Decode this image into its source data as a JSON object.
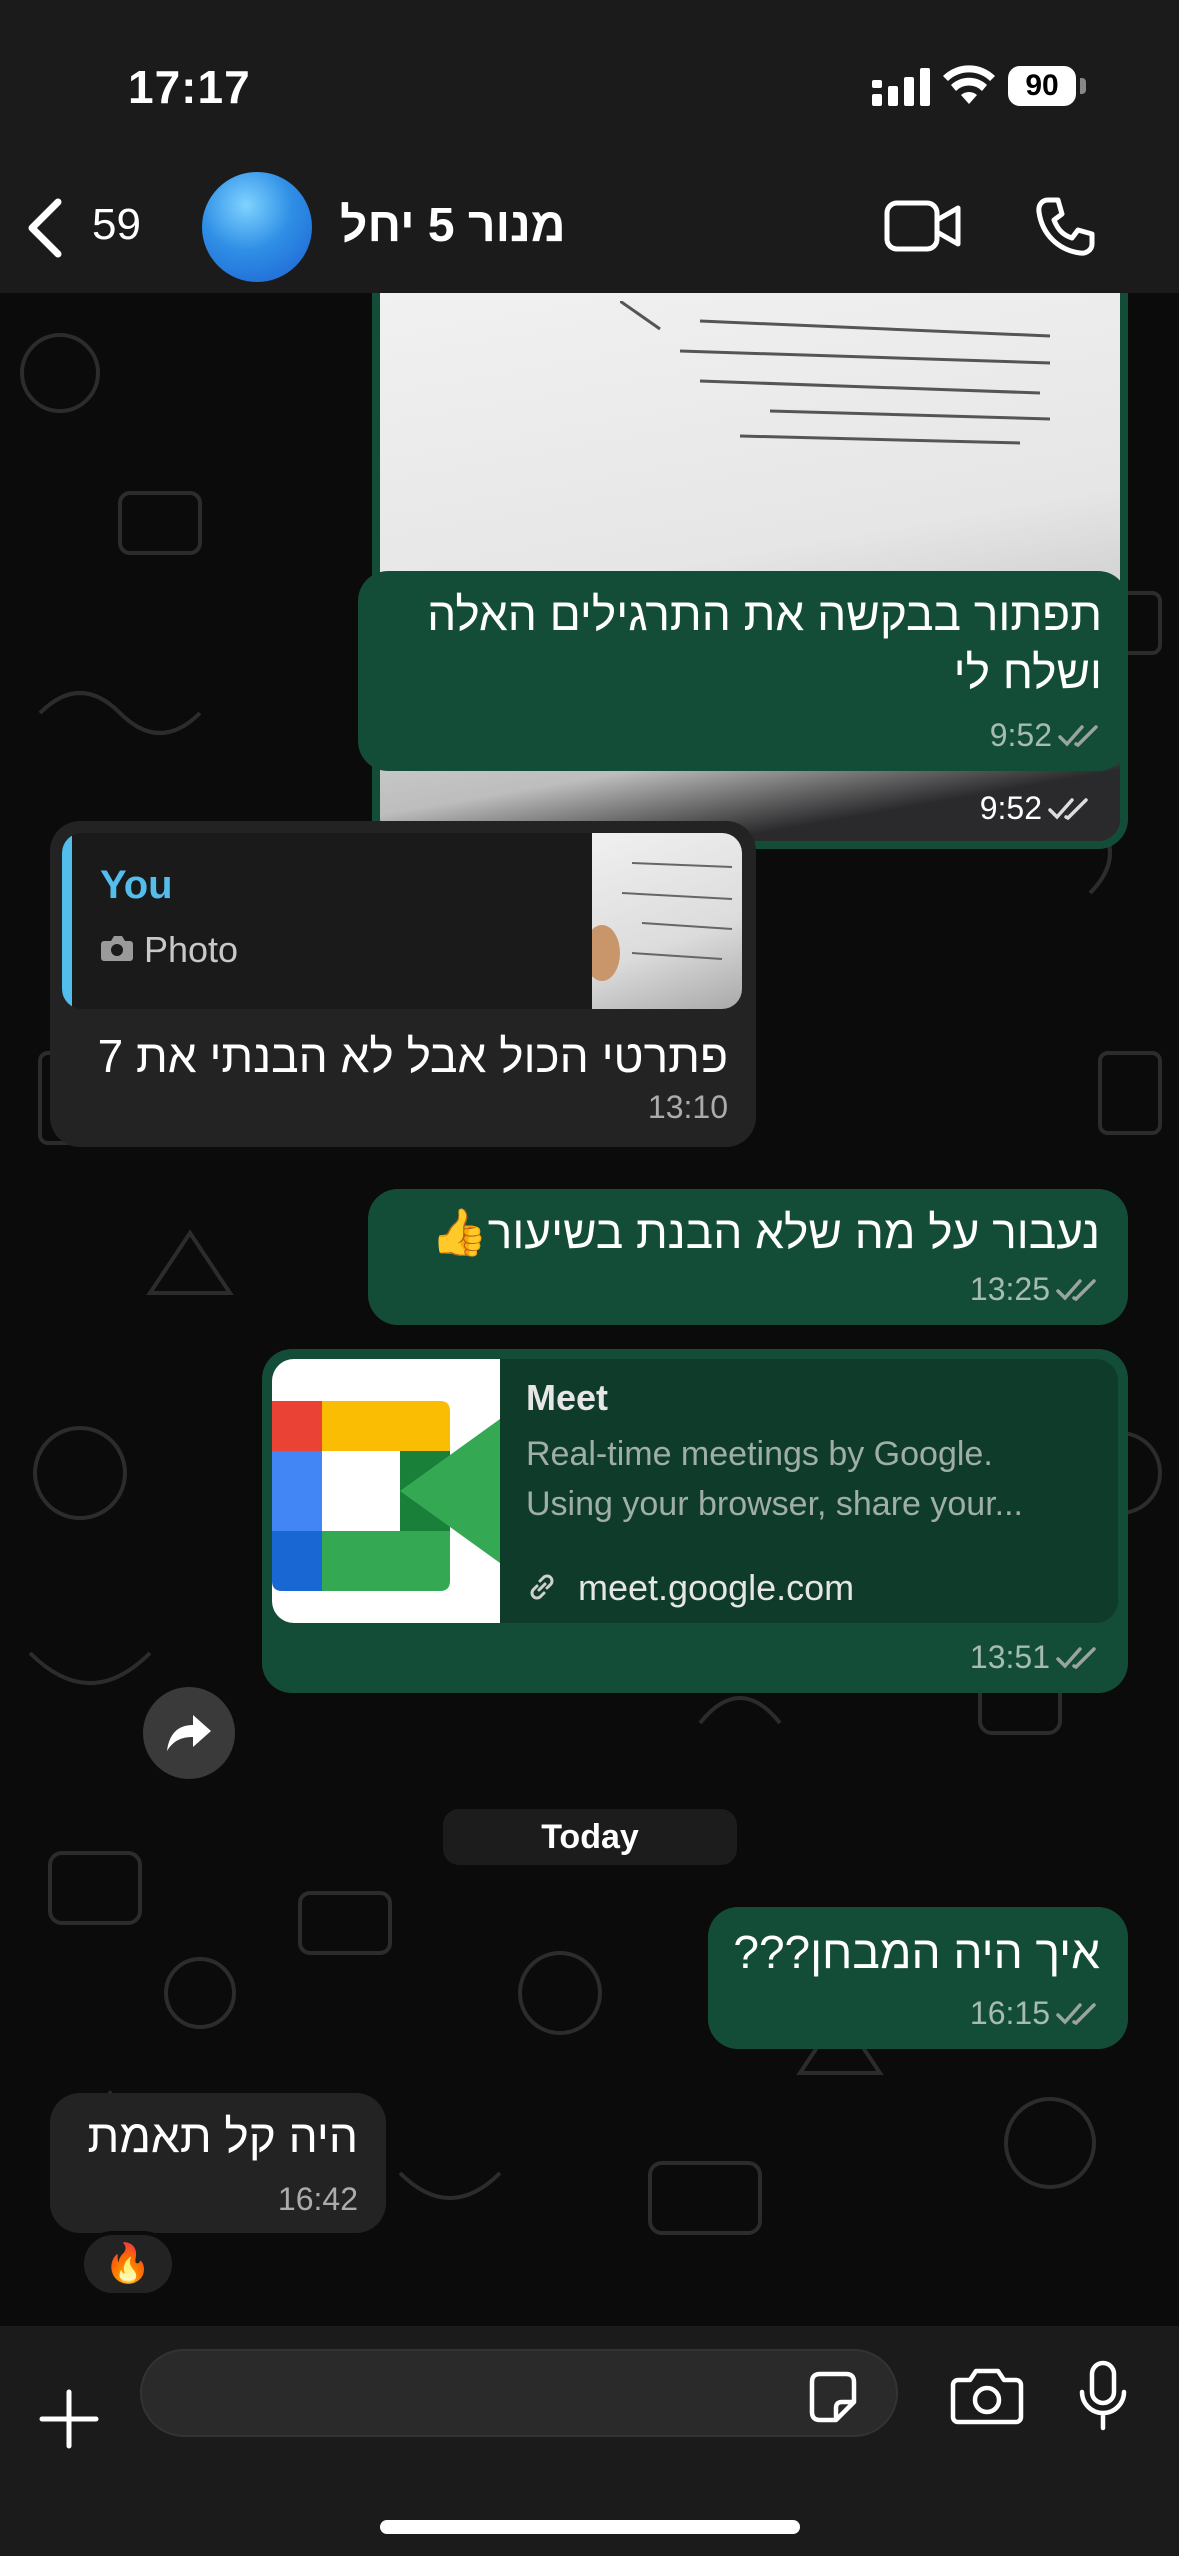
{
  "status": {
    "time": "17:17",
    "battery": "90"
  },
  "header": {
    "back_count": "59",
    "contact_name": "מנור 5 יחל"
  },
  "messages": {
    "photo": {
      "time": "9:52"
    },
    "m1": {
      "text": "תפתור בבקשה את התרגילים האלה ושלח לי",
      "time": "9:52"
    },
    "m2": {
      "quote_author": "You",
      "quote_type": "Photo",
      "text": "פתרטי הכול אבל לא הבנתי את 7",
      "time": "13:10"
    },
    "m3": {
      "text": "נעבור על מה שלא הבנת בשיעור",
      "emoji": "👍",
      "time": "13:25"
    },
    "m4": {
      "link_title": "Meet",
      "link_desc_1": "Real-time meetings by Google.",
      "link_desc_2": "Using your browser, share your...",
      "link_url": "meet.google.com",
      "time": "13:51"
    },
    "date_divider": "Today",
    "m5": {
      "text": "איך היה המבחן???",
      "time": "16:15"
    },
    "m6": {
      "text": "היה קל תאמת",
      "time": "16:42",
      "reaction": "🔥"
    }
  },
  "composer": {
    "placeholder": ""
  },
  "icons": [
    "chevron-left-icon",
    "video-camera-icon",
    "phone-icon",
    "double-check-icon",
    "forward-icon",
    "link-icon",
    "plus-icon",
    "sticker-icon",
    "camera-icon",
    "microphone-icon",
    "wifi-icon",
    "signal-icon"
  ],
  "colors": {
    "outgoing_bubble": "#134d37",
    "incoming_bubble": "#232323",
    "quote_accent": "#53bdeb",
    "read_ticks": "#9aa5a0"
  }
}
